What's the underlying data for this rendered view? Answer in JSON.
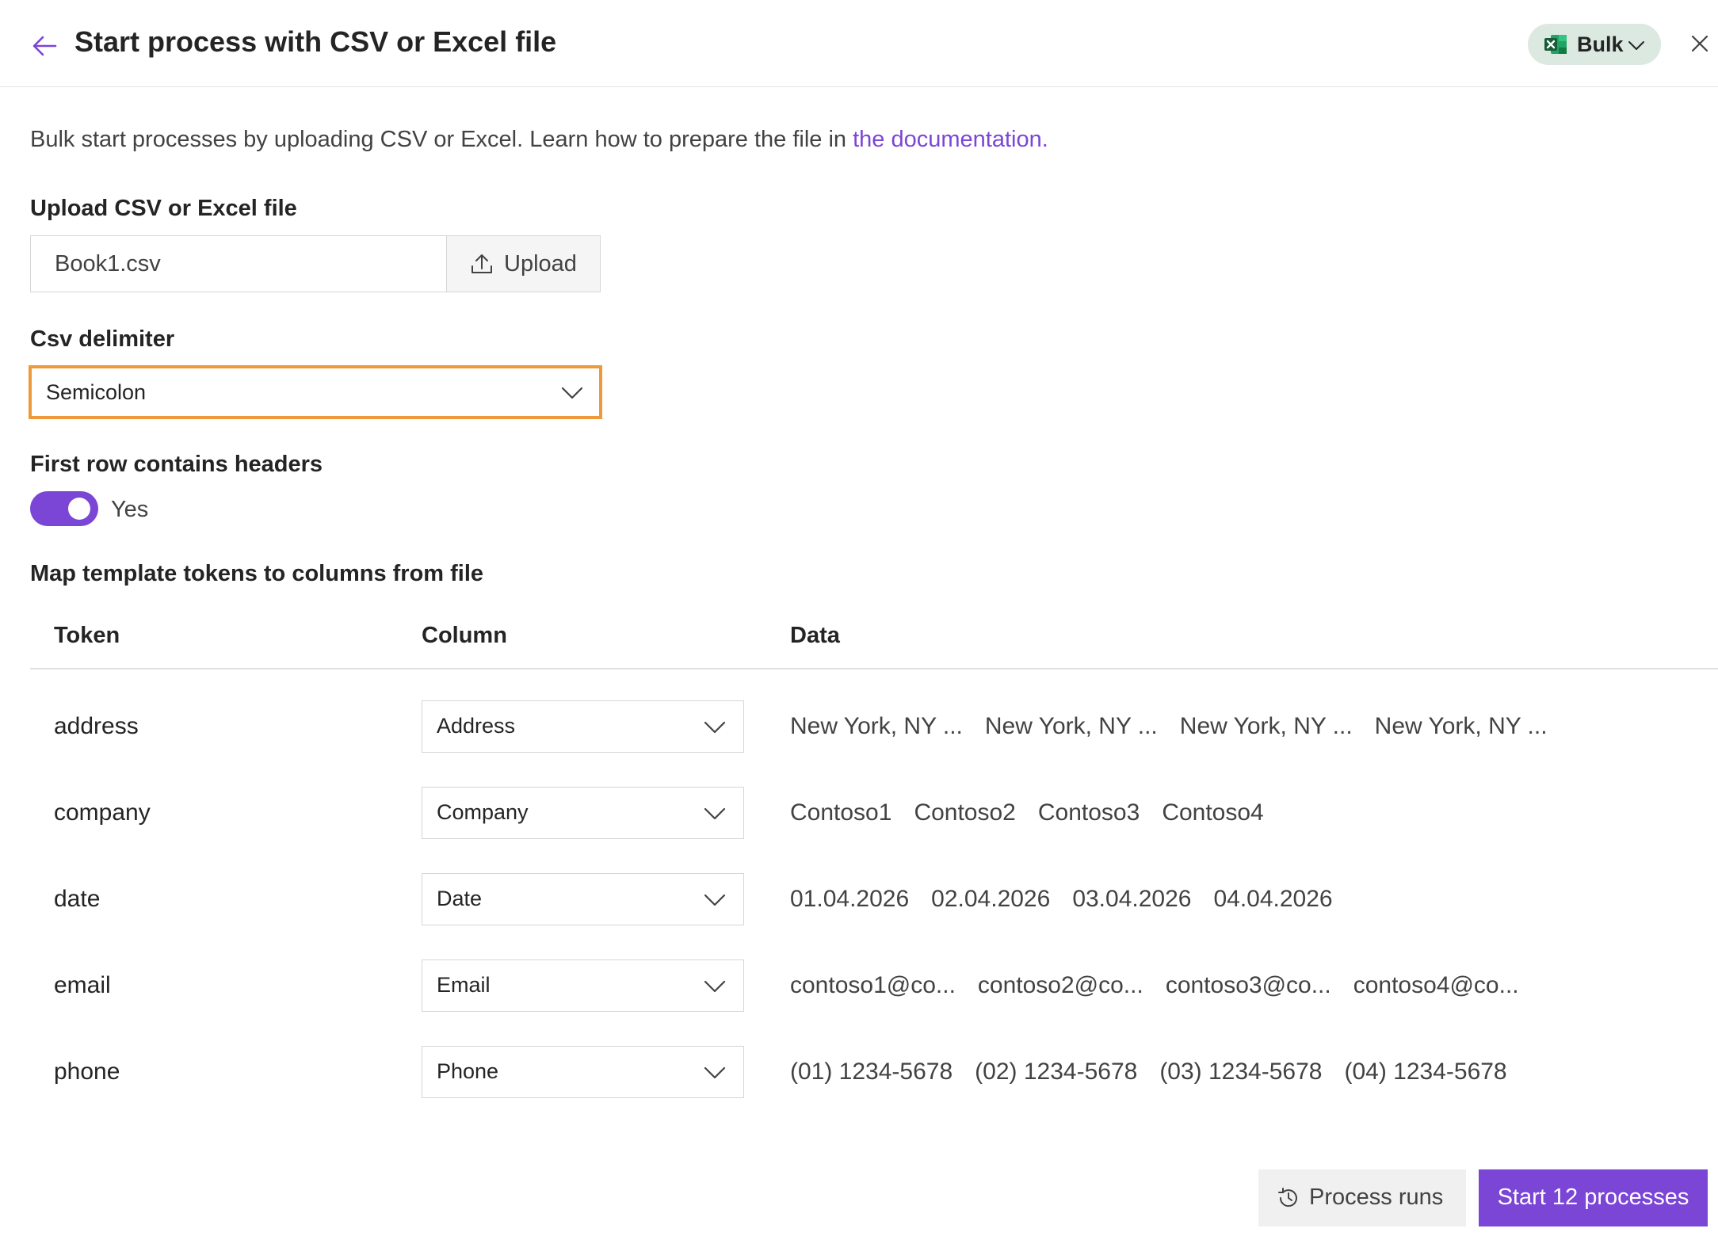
{
  "header": {
    "title": "Start process with CSV or Excel file",
    "mode_label": "Bulk",
    "back_icon": "arrow-left-icon",
    "close_icon": "close-icon",
    "mode_icon": "excel-icon"
  },
  "intro": {
    "text": "Bulk start processes by uploading CSV or Excel. Learn how to prepare the file in ",
    "link_text": "the documentation."
  },
  "upload": {
    "label": "Upload CSV or Excel file",
    "file_name": "Book1.csv",
    "button_label": "Upload"
  },
  "delimiter": {
    "label": "Csv delimiter",
    "value": "Semicolon"
  },
  "headers_toggle": {
    "label": "First row contains headers",
    "state_label": "Yes",
    "on": true
  },
  "mapping": {
    "label": "Map template tokens to columns from file",
    "columns": [
      "Token",
      "Column",
      "Data"
    ],
    "rows": [
      {
        "token": "address",
        "column": "Address",
        "data": [
          "New York, NY ...",
          "New York, NY ...",
          "New York, NY ...",
          "New York, NY ..."
        ]
      },
      {
        "token": "company",
        "column": "Company",
        "data": [
          "Contoso1",
          "Contoso2",
          "Contoso3",
          "Contoso4"
        ]
      },
      {
        "token": "date",
        "column": "Date",
        "data": [
          "01.04.2026",
          "02.04.2026",
          "03.04.2026",
          "04.04.2026"
        ]
      },
      {
        "token": "email",
        "column": "Email",
        "data": [
          "contoso1@co...",
          "contoso2@co...",
          "contoso3@co...",
          "contoso4@co..."
        ]
      },
      {
        "token": "phone",
        "column": "Phone",
        "data": [
          "(01) 1234-5678",
          "(02) 1234-5678",
          "(03) 1234-5678",
          "(04) 1234-5678"
        ]
      }
    ]
  },
  "footer": {
    "runs_label": "Process runs",
    "start_label": "Start 12 processes"
  },
  "colors": {
    "accent": "#7b45d6",
    "focus_border": "#ee9a3a",
    "mode_pill_bg": "#dbe9e1"
  }
}
